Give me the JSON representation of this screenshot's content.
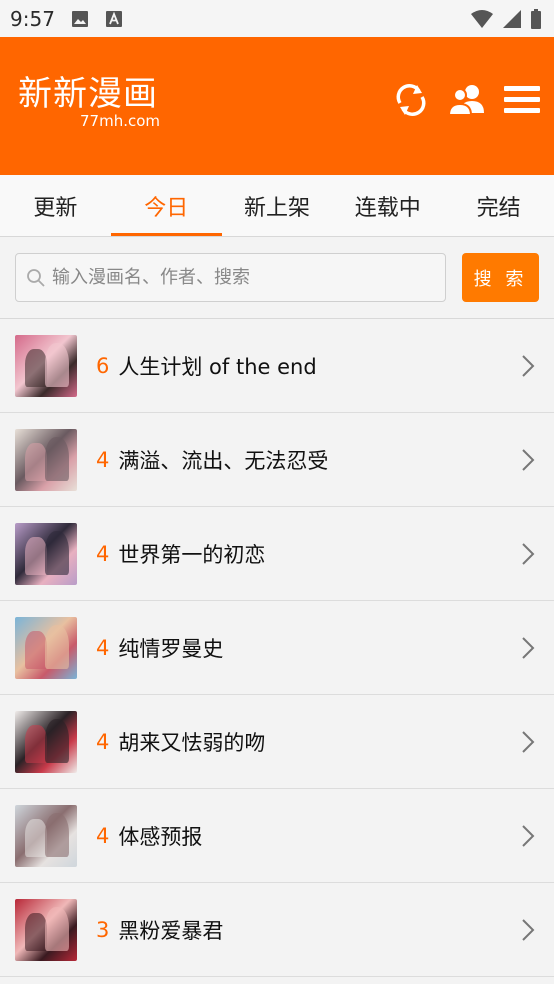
{
  "status_bar": {
    "time": "9:57"
  },
  "header": {
    "logo_text": "新新漫画",
    "logo_domain": "77mh.com",
    "brand_color": "#ff6600"
  },
  "tabs": [
    {
      "label": "更新",
      "active": false
    },
    {
      "label": "今日",
      "active": true
    },
    {
      "label": "新上架",
      "active": false
    },
    {
      "label": "连载中",
      "active": false
    },
    {
      "label": "完结",
      "active": false
    }
  ],
  "search": {
    "placeholder": "输入漫画名、作者、搜索",
    "button_label": "搜 索"
  },
  "comics": [
    {
      "count": "6",
      "title": "人生计划 of the end",
      "cover_colors": [
        "#d46a8a",
        "#f2c6cf",
        "#3a2a2a"
      ]
    },
    {
      "count": "4",
      "title": "满溢、流出、无法忍受",
      "cover_colors": [
        "#e8e0d8",
        "#6a5a60",
        "#d9a0a8"
      ]
    },
    {
      "count": "4",
      "title": "世界第一的初恋",
      "cover_colors": [
        "#b89cc8",
        "#2f2a3a",
        "#e8b0c0"
      ]
    },
    {
      "count": "4",
      "title": "纯情罗曼史",
      "cover_colors": [
        "#7ab4d8",
        "#e8c0a0",
        "#c85a6a"
      ]
    },
    {
      "count": "4",
      "title": "胡来又怯弱的吻",
      "cover_colors": [
        "#f0ecea",
        "#2a2226",
        "#c83a4a"
      ]
    },
    {
      "count": "4",
      "title": "体感预报",
      "cover_colors": [
        "#cfd6dc",
        "#8a6e70",
        "#e6e2e0"
      ]
    },
    {
      "count": "3",
      "title": "黑粉爱暴君",
      "cover_colors": [
        "#b82838",
        "#f0b8b8",
        "#3a1a20"
      ]
    }
  ]
}
